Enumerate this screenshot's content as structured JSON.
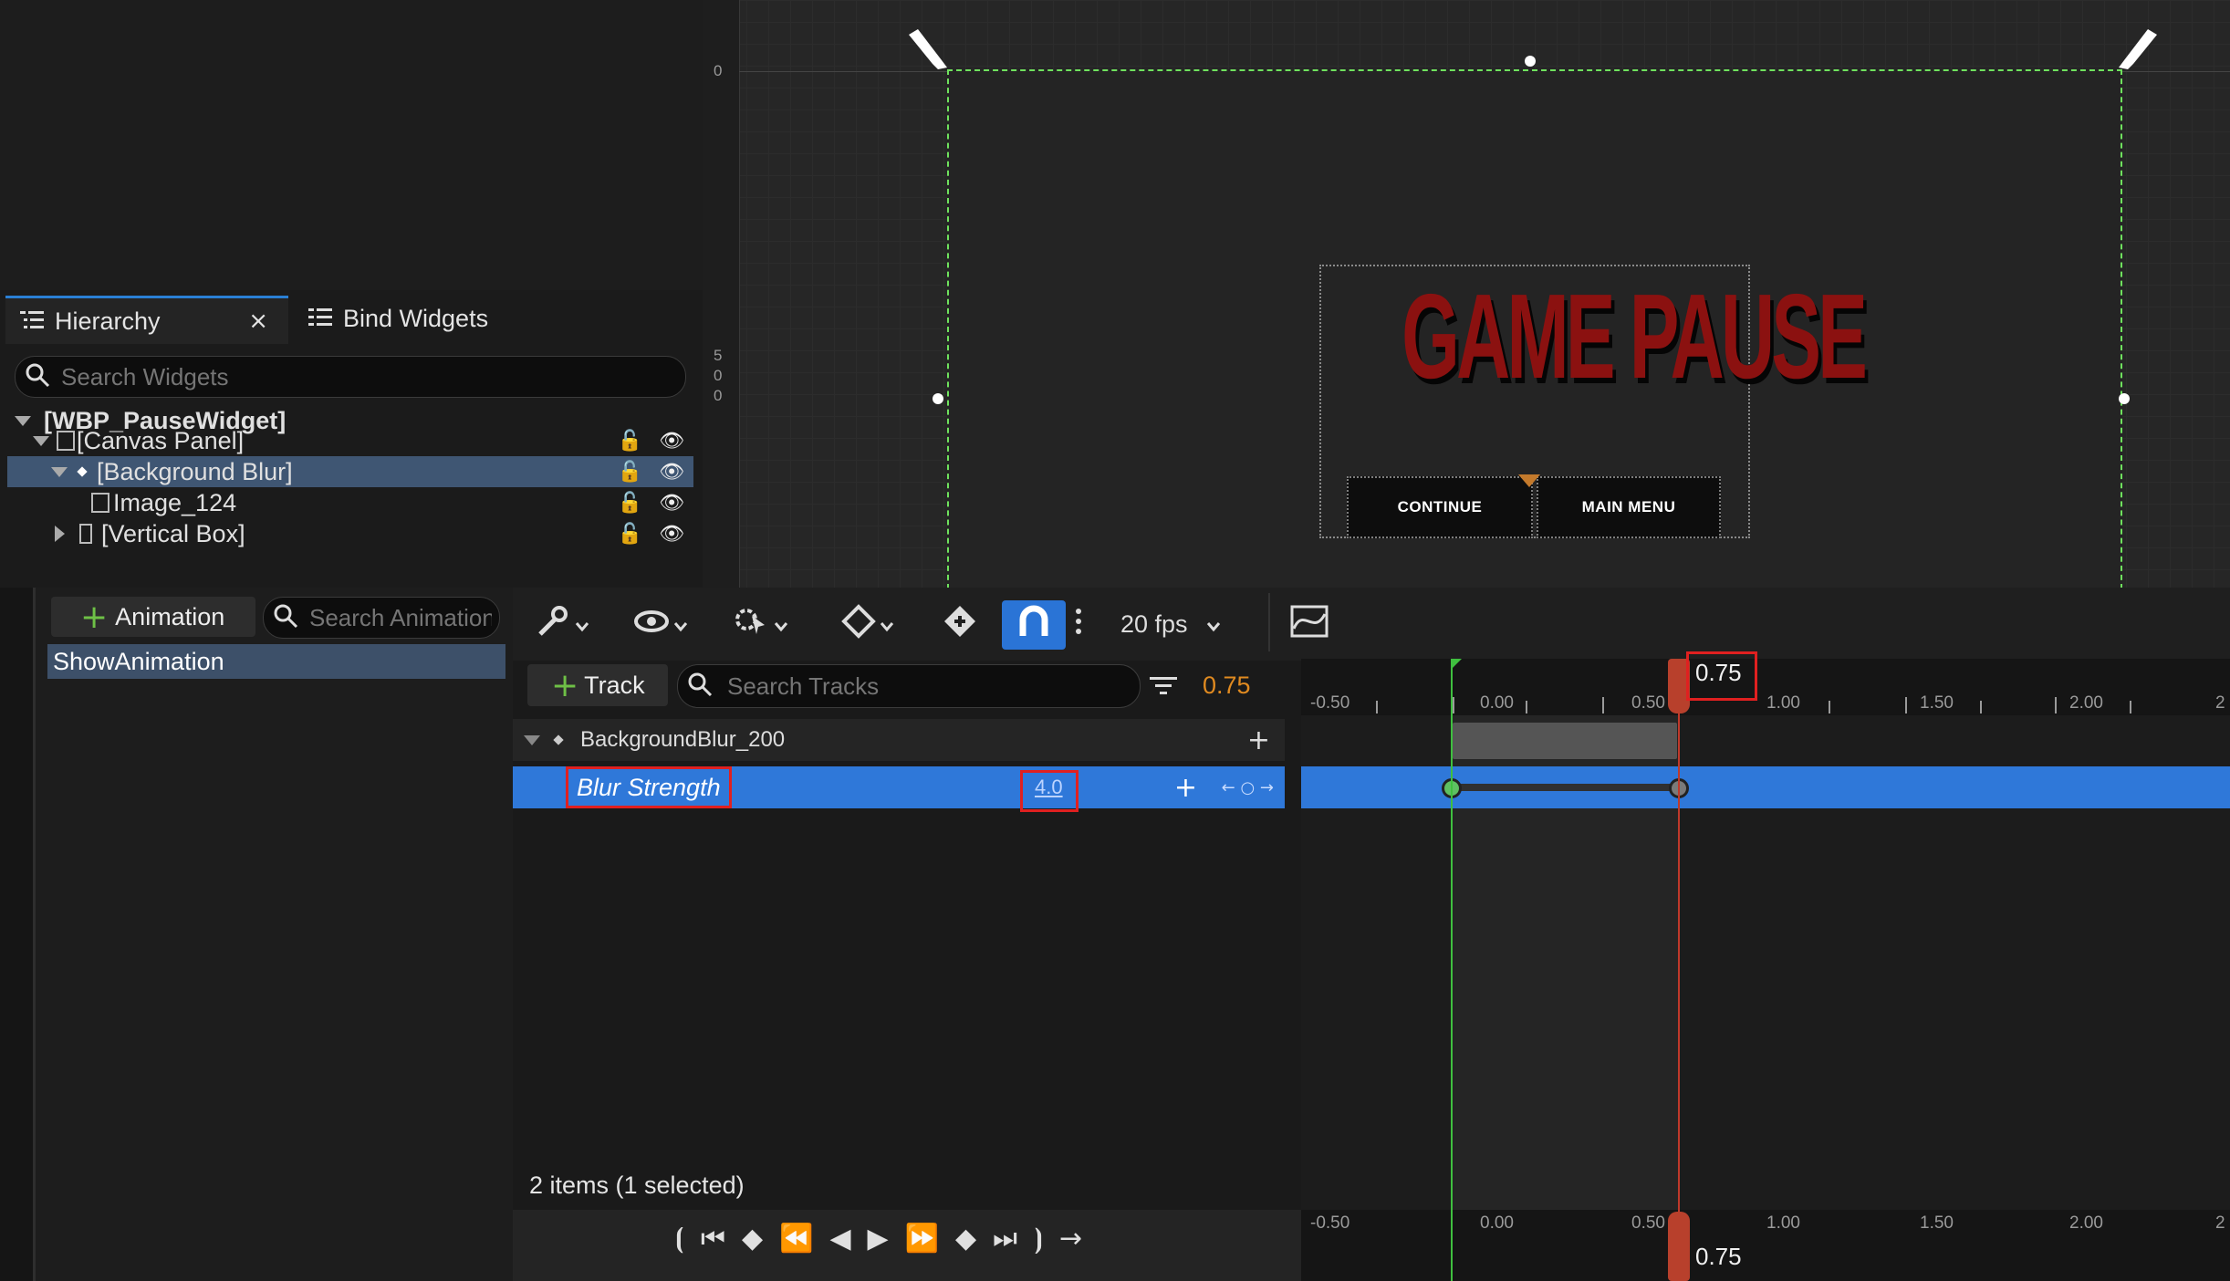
{
  "hierarchy": {
    "tab_label": "Hierarchy",
    "close_glyph": "×",
    "bind_tab_label": "Bind Widgets",
    "search_placeholder": "Search Widgets",
    "rows": [
      {
        "label": "[WBP_PauseWidget]"
      },
      {
        "label": "[Canvas Panel]"
      },
      {
        "label": "[Background Blur]"
      },
      {
        "label": "Image_124"
      },
      {
        "label": "[Vertical Box]"
      }
    ]
  },
  "viewport": {
    "ruler_top": "0",
    "ruler_mid": [
      "5",
      "0",
      "0"
    ],
    "title_text": "GAME PAUSE",
    "continue_label": "CONTINUE",
    "main_menu_label": "MAIN MENU"
  },
  "animations": {
    "add_label": "Animation",
    "search_placeholder": "Search Animations",
    "items": [
      "ShowAnimation"
    ]
  },
  "sequencer": {
    "fps_label": "20 fps",
    "track_label": "Track",
    "search_placeholder": "Search Tracks",
    "current_time": "0.75",
    "tracks": [
      {
        "label": "BackgroundBlur_200"
      },
      {
        "label": "Blur Strength",
        "value": "4.0"
      }
    ],
    "status": "2 items (1 selected)"
  },
  "timeline": {
    "ticks": [
      "-0.50",
      "0.00",
      "0.50",
      "1.00",
      "1.50",
      "2.00",
      "2"
    ],
    "playhead_label": "0.75",
    "bottom_playhead_label": "0.75"
  },
  "colors": {
    "accent": "#2f78d9",
    "selection": "#3f5673",
    "title_red": "#8b1110",
    "playhead": "#c0392b",
    "start_marker": "#3fbf3f",
    "current_time": "#e08a20"
  },
  "icons": [
    "hierarchy-icon",
    "close-icon",
    "bind-widgets-icon",
    "search-icon",
    "lock-icon",
    "eye-icon",
    "plus-icon",
    "wrench-icon",
    "eye-toggle-icon",
    "gear-cursor-icon",
    "key-diamond-icon",
    "key-add-icon",
    "magnet-icon",
    "more-icon",
    "chevron-down-icon",
    "curve-editor-icon",
    "filter-icon",
    "play-icon"
  ]
}
